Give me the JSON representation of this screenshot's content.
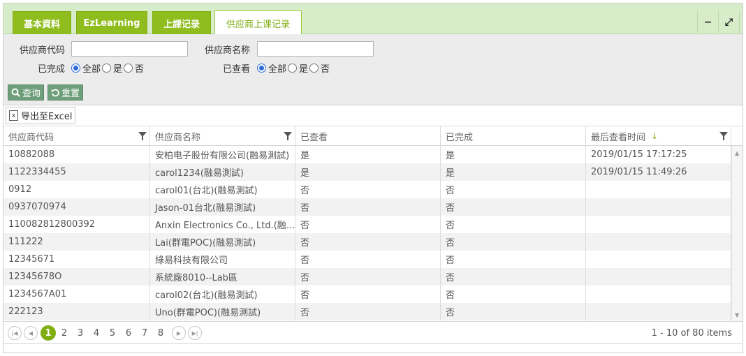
{
  "tabs": [
    {
      "label": "基本資料",
      "active": false
    },
    {
      "label": "EzLearning",
      "active": false
    },
    {
      "label": "上課记录",
      "active": false
    },
    {
      "label": "供应商上课记录",
      "active": true
    }
  ],
  "window_buttons": {
    "minimize": "−",
    "maximize": "⤢"
  },
  "filter": {
    "vendor_code_label": "供应商代码",
    "vendor_code_value": "",
    "vendor_name_label": "供应商名称",
    "vendor_name_value": "",
    "completed_label": "已完成",
    "viewed_label": "已查看",
    "options": [
      "全部",
      "是",
      "否"
    ],
    "completed_selected": "全部",
    "viewed_selected": "全部",
    "search_button": "查询",
    "reset_button": "重置"
  },
  "toolbar": {
    "export_label": "导出至Excel"
  },
  "grid": {
    "columns": [
      "供应商代码",
      "供应商名称",
      "已查看",
      "已完成",
      "最后查看时间"
    ],
    "sorted_column": "最后查看时间",
    "sort_direction": "descending",
    "rows": [
      [
        "10882088",
        "安柏电子股份有限公司(融易測試)",
        "是",
        "是",
        "2019/01/15 17:17:25"
      ],
      [
        "1122334455",
        "carol1234(融易測試)",
        "是",
        "是",
        "2019/01/15 11:49:26"
      ],
      [
        "0912",
        "carol01(台北)(融易測試)",
        "否",
        "否",
        ""
      ],
      [
        "0937070974",
        "Jason-01台北(融易測試)",
        "否",
        "否",
        ""
      ],
      [
        "110082812800392",
        "Anxin Electronics Co., Ltd.(融…",
        "否",
        "否",
        ""
      ],
      [
        "111222",
        "Lai(群電POC)(融易測試)",
        "否",
        "否",
        ""
      ],
      [
        "12345671",
        "綠易科技有限公司",
        "否",
        "否",
        ""
      ],
      [
        "12345678O",
        "系統廠8010--Lab區",
        "否",
        "否",
        ""
      ],
      [
        "1234567A01",
        "carol02(台北)(融易測試)",
        "否",
        "否",
        ""
      ],
      [
        "222123",
        "Uno(群電POC)(融易測試)",
        "否",
        "否",
        ""
      ]
    ]
  },
  "pager": {
    "pages": [
      "1",
      "2",
      "3",
      "4",
      "5",
      "6",
      "7",
      "8"
    ],
    "current_page": "1",
    "info": "1 - 10 of 80 items"
  }
}
